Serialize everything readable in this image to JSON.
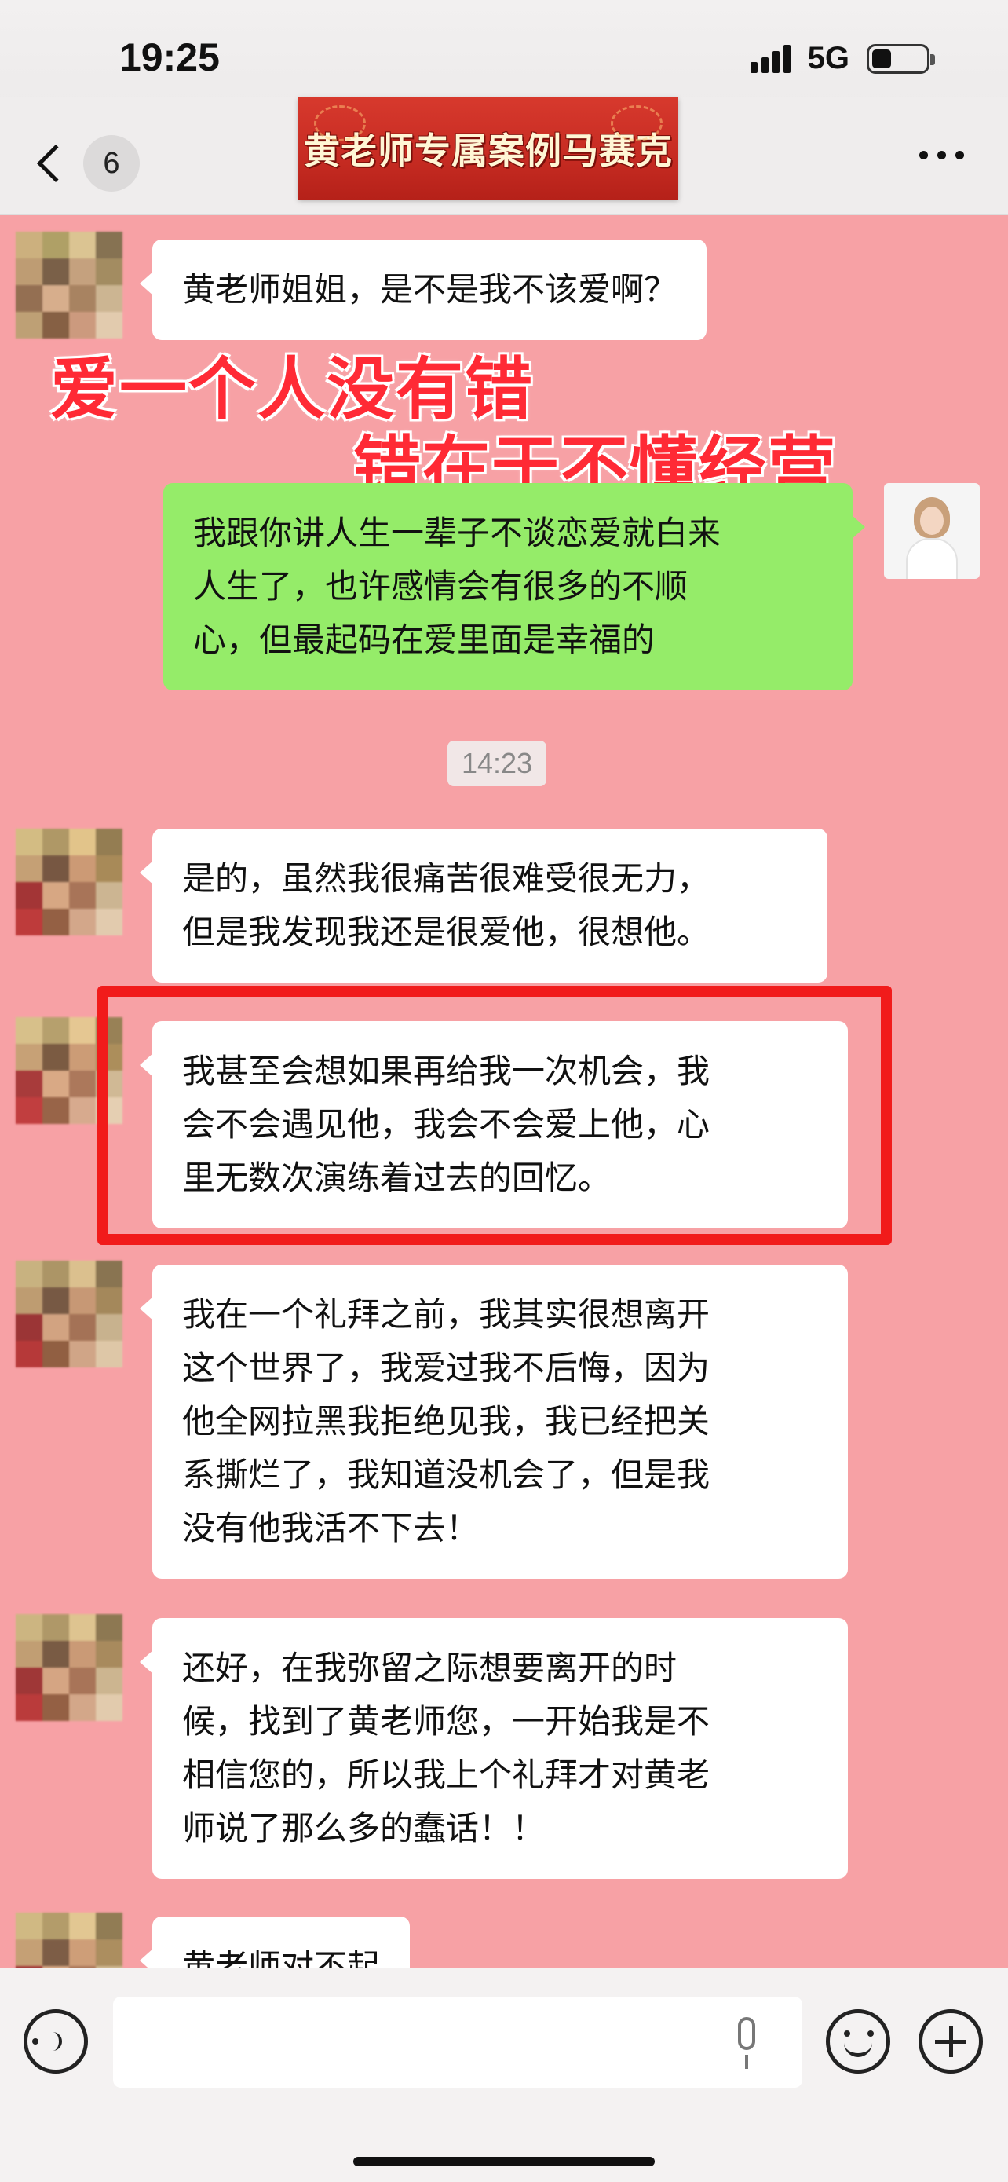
{
  "status_bar": {
    "time": "19:25",
    "network": "5G"
  },
  "nav": {
    "unread_count": "6",
    "title": "黄老师专属案例马赛克"
  },
  "overlays": {
    "line1": "爱一个人没有错",
    "line2": "错在于不懂经营"
  },
  "messages": [
    {
      "side": "left",
      "text": "黄老师姐姐，是不是我不该爱啊？"
    },
    {
      "side": "right",
      "lines": [
        "我跟你讲人生一辈子不谈恋爱就白来",
        "人生了，也许感情会有很多的不顺",
        "心，但最起码在爱里面是幸福的"
      ]
    },
    {
      "side": "left",
      "lines": [
        "是的，虽然我很痛苦很难受很无力，",
        "但是我发现我还是很爱他，很想他。"
      ]
    },
    {
      "side": "left",
      "lines": [
        "我甚至会想如果再给我一次机会，我",
        "会不会遇见他，我会不会爱上他，心",
        "里无数次演练着过去的回忆。"
      ]
    },
    {
      "side": "left",
      "lines": [
        "我在一个礼拜之前，我其实很想离开",
        "这个世界了，我爱过我不后悔，因为",
        "他全网拉黑我拒绝见我，我已经把关",
        "系撕烂了，我知道没机会了，但是我",
        "没有他我活不下去！"
      ]
    },
    {
      "side": "left",
      "lines": [
        "还好，在我弥留之际想要离开的时",
        "候，找到了黄老师您，一开始我是不",
        "相信您的，所以我上个礼拜才对黄老",
        "师说了那么多的蠢话！！"
      ]
    },
    {
      "side": "left",
      "text": "黄老师对不起"
    }
  ],
  "timestamp": "14:23",
  "colors": {
    "chat_background": "#f7a1a5",
    "my_bubble": "#95ec69",
    "highlight": "#f11b1b",
    "overlay_text": "#ff2a35"
  }
}
